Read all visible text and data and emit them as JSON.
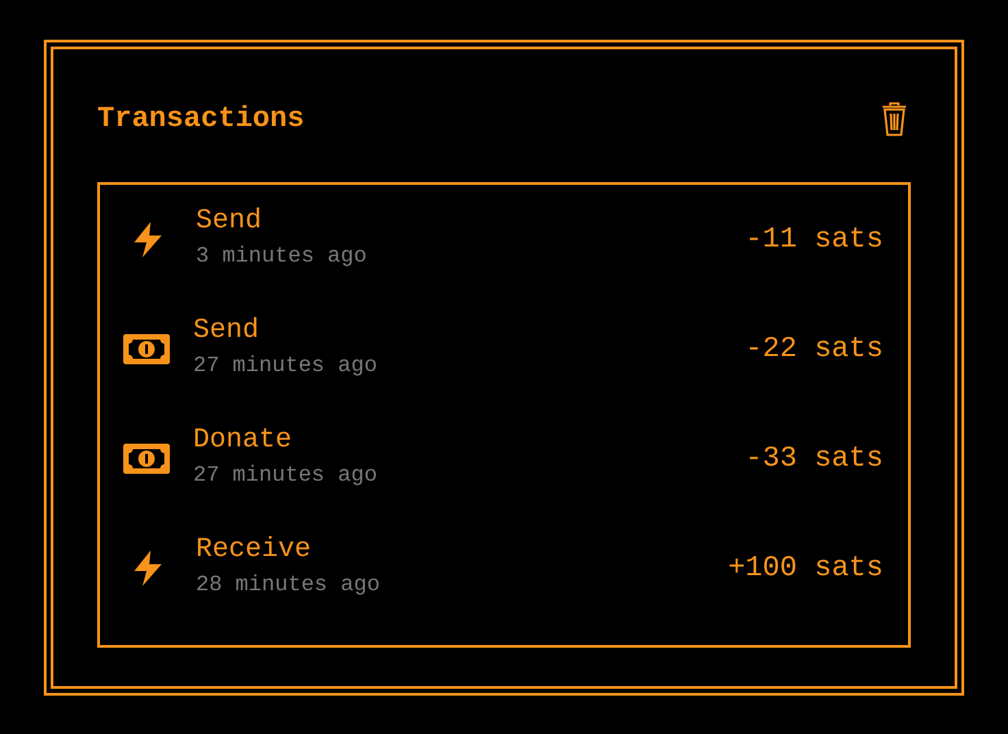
{
  "title": "Transactions",
  "transactions": [
    {
      "kind": "lightning",
      "label": "Send",
      "time": "3 minutes ago",
      "amount": "-11 sats"
    },
    {
      "kind": "cash",
      "label": "Send",
      "time": "27 minutes ago",
      "amount": "-22 sats"
    },
    {
      "kind": "cash",
      "label": "Donate",
      "time": "27 minutes ago",
      "amount": "-33 sats"
    },
    {
      "kind": "lightning",
      "label": "Receive",
      "time": "28 minutes ago",
      "amount": "+100 sats"
    }
  ]
}
